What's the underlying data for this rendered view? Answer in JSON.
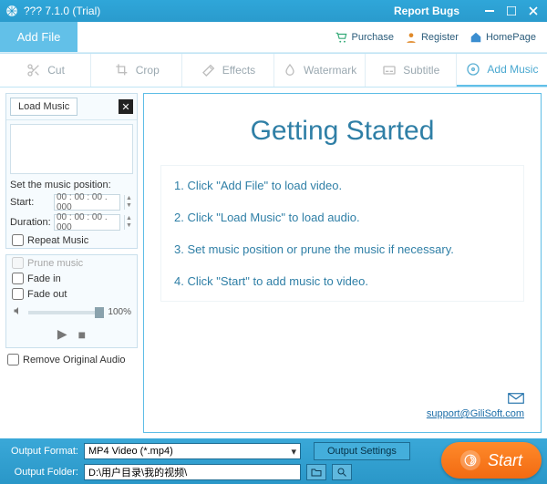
{
  "titlebar": {
    "title": "??? 7.1.0 (Trial)",
    "report": "Report Bugs"
  },
  "secondbar": {
    "add_file": "Add File",
    "links": {
      "purchase": "Purchase",
      "register": "Register",
      "homepage": "HomePage"
    }
  },
  "tabs": {
    "cut": "Cut",
    "crop": "Crop",
    "effects": "Effects",
    "watermark": "Watermark",
    "subtitle": "Subtitle",
    "add_music": "Add Music"
  },
  "side": {
    "load_music": "Load Music",
    "pos_label": "Set the music position:",
    "start_label": "Start:",
    "start_value": "00 : 00 : 00 . 000",
    "duration_label": "Duration:",
    "duration_value": "00 : 00 : 00 . 000",
    "repeat": "Repeat Music",
    "prune": "Prune music",
    "fade_in": "Fade in",
    "fade_out": "Fade out",
    "volume": "100%",
    "remove_audio": "Remove Original Audio"
  },
  "content": {
    "title": "Getting Started",
    "steps": [
      "1. Click \"Add File\" to load video.",
      "2. Click \"Load Music\" to load audio.",
      "3. Set music position or prune the music if necessary.",
      "4. Click \"Start\" to add music to video."
    ],
    "support": "support@GiliSoft.com"
  },
  "bottom": {
    "format_label": "Output Format:",
    "format_value": "MP4 Video (*.mp4)",
    "output_settings": "Output Settings",
    "folder_label": "Output Folder:",
    "folder_value": "D:\\用户目录\\我的视频\\",
    "start": "Start"
  }
}
